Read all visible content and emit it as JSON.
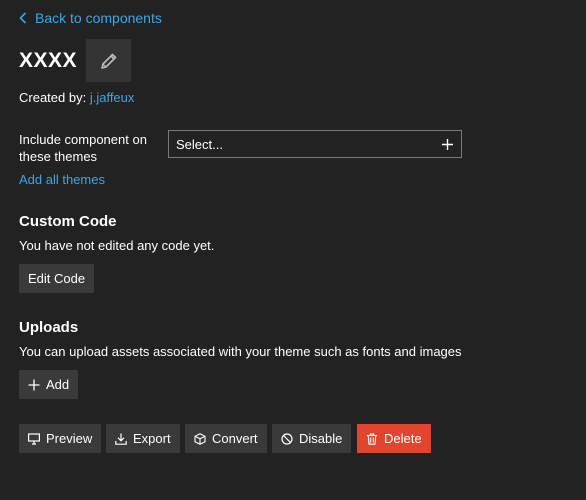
{
  "nav": {
    "back_label": "Back to components"
  },
  "component": {
    "title": "XXXX"
  },
  "created": {
    "prefix": "Created by:",
    "author": "j.jaffeux"
  },
  "themes": {
    "include_label": "Include component on these themes",
    "select_placeholder": "Select...",
    "add_all_label": "Add all themes"
  },
  "custom_code": {
    "heading": "Custom Code",
    "description": "You have not edited any code yet.",
    "edit_label": "Edit Code"
  },
  "uploads": {
    "heading": "Uploads",
    "description": "You can upload assets associated with your theme such as fonts and images",
    "add_label": "Add"
  },
  "actions": {
    "preview": "Preview",
    "export": "Export",
    "convert": "Convert",
    "disable": "Disable",
    "delete": "Delete"
  },
  "colors": {
    "link": "#3ba7e6",
    "danger": "#e2452d",
    "background": "#222222",
    "button": "#3a3a3a"
  },
  "icons": [
    "chevron-left-icon",
    "pencil-icon",
    "plus-icon",
    "desktop-icon",
    "download-icon",
    "cube-icon",
    "ban-icon",
    "trash-icon"
  ]
}
